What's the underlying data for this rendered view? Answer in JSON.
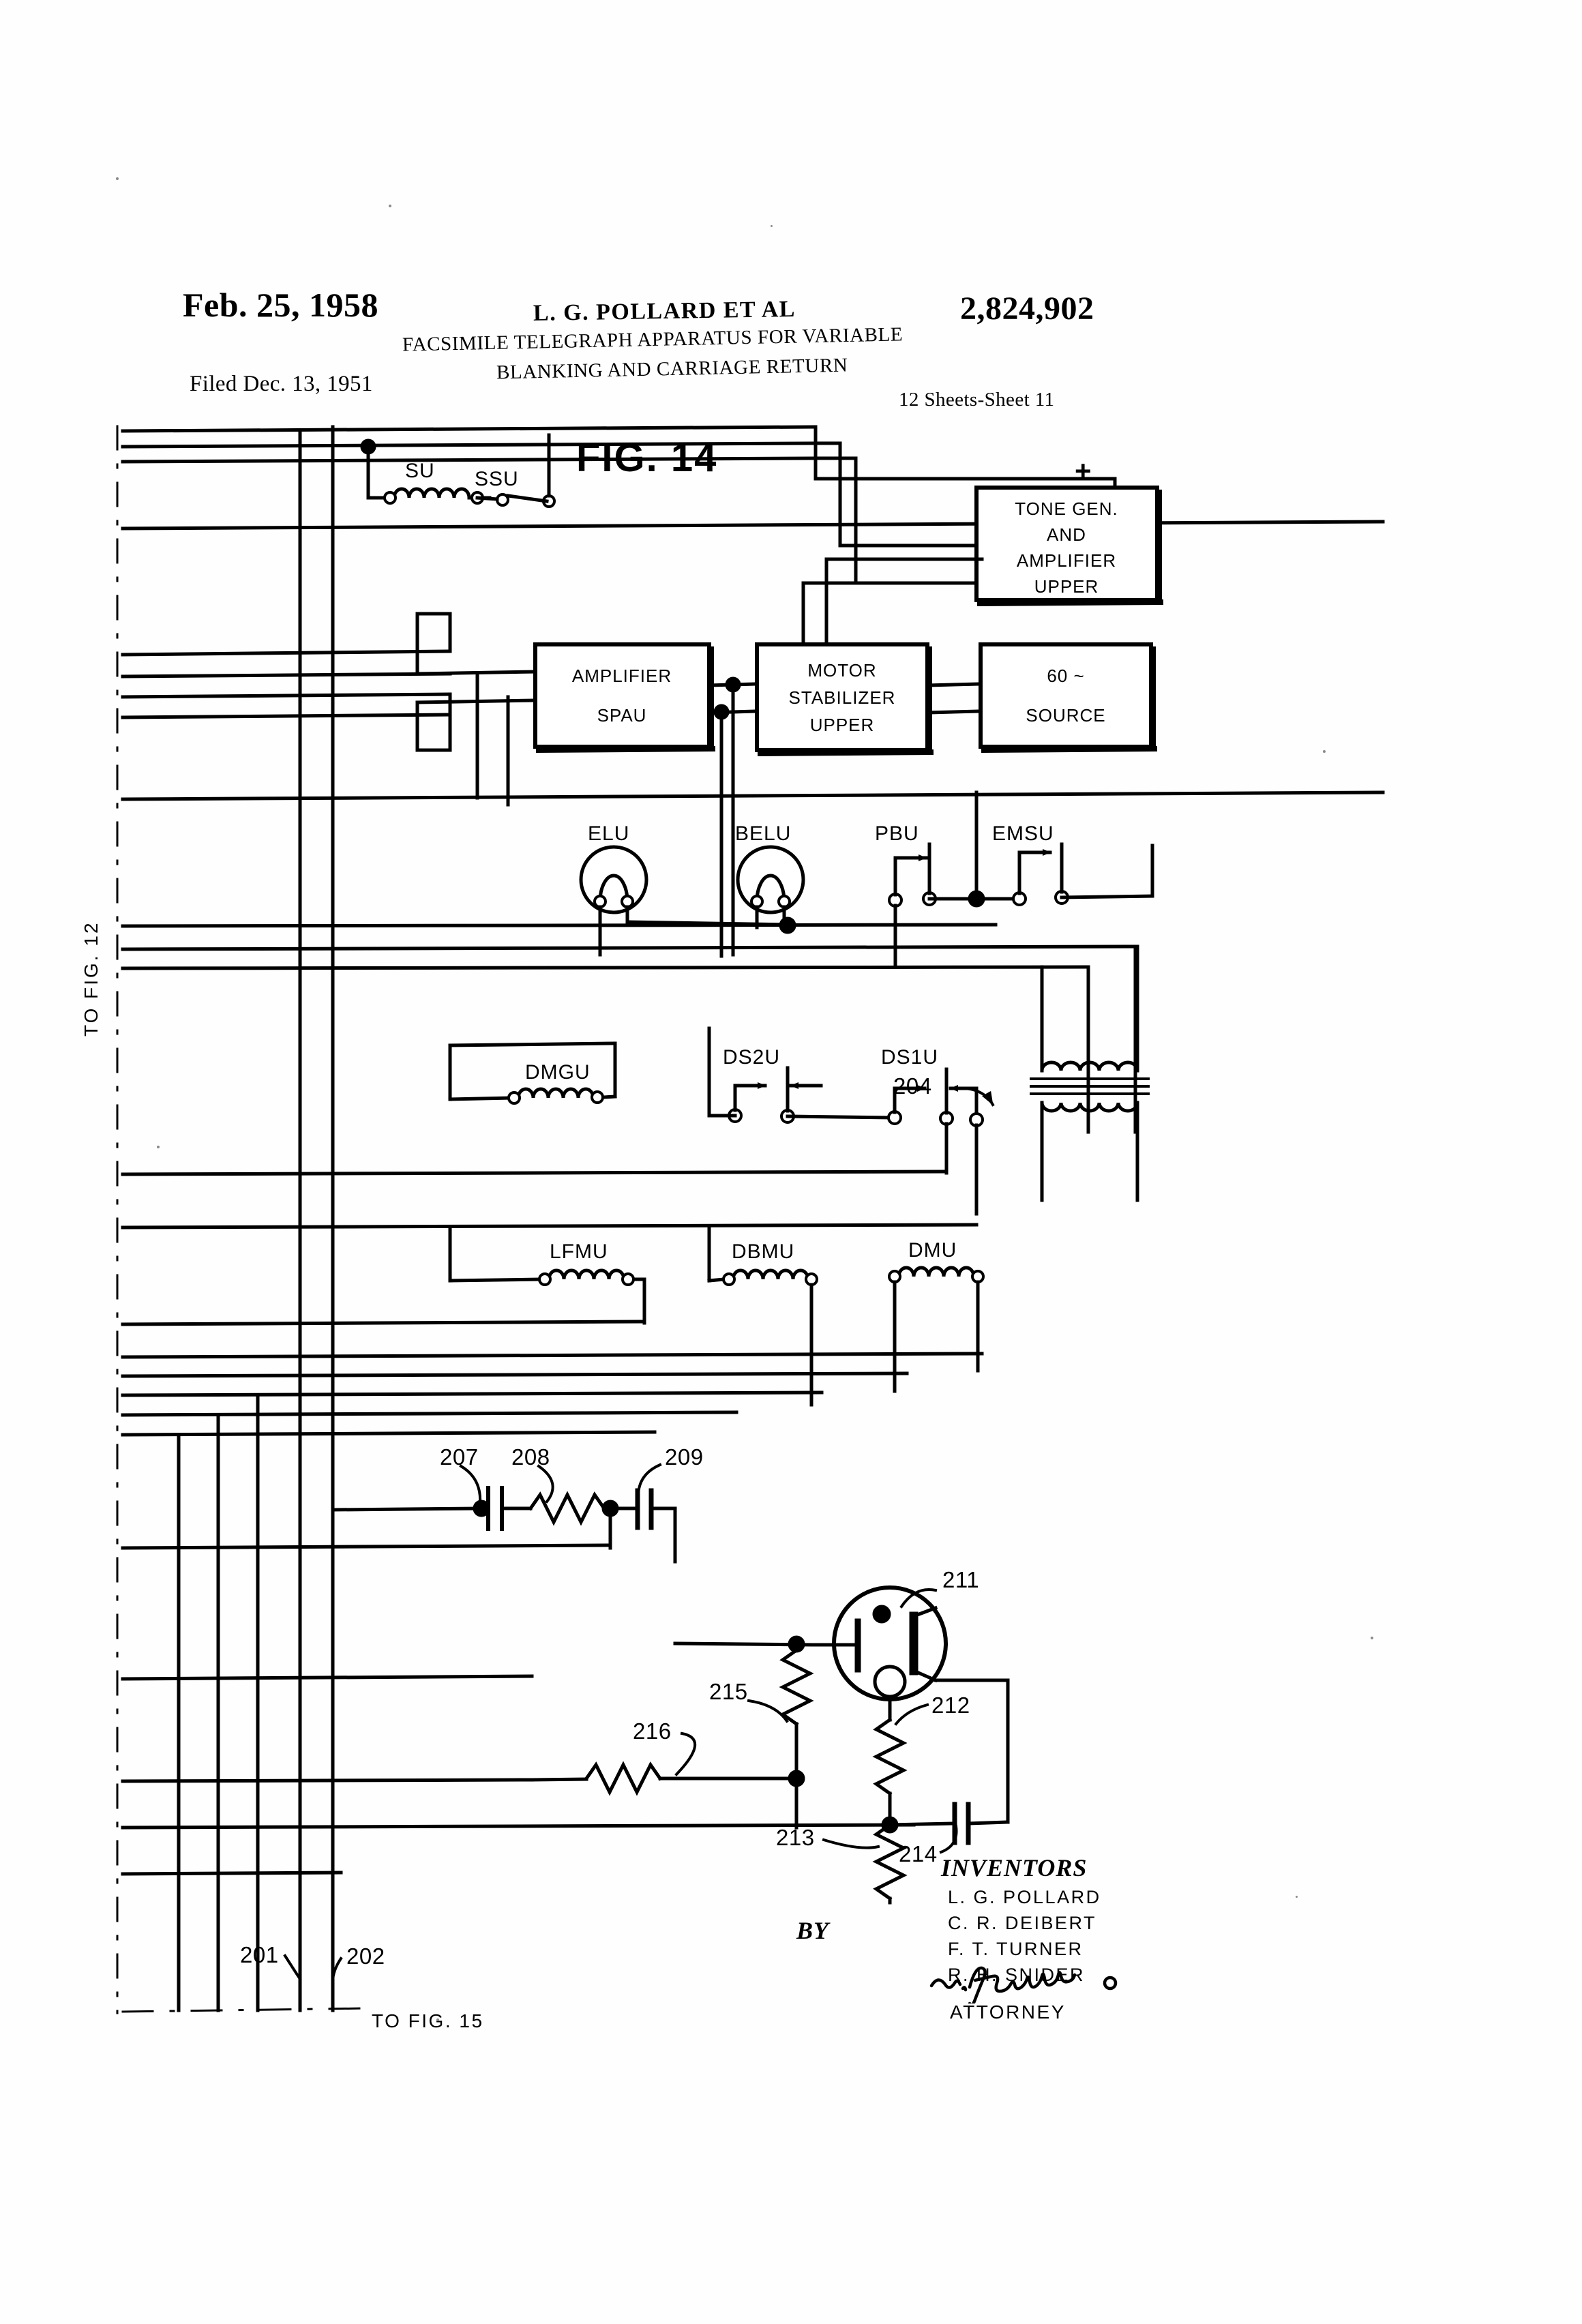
{
  "header": {
    "date": "Feb. 25, 1958",
    "inventor_line": "L. G. POLLARD  ET AL",
    "patent_number": "2,824,902",
    "title_line1": "FACSIMILE TELEGRAPH APPARATUS FOR VARIABLE",
    "title_line2": "BLANKING AND CARRIAGE RETURN",
    "filed": "Filed Dec. 13, 1951",
    "sheets": "12 Sheets-Sheet 11"
  },
  "figure": {
    "label": "FIG. 14",
    "to_fig_left": "TO FIG. 12",
    "to_fig_bottom": "TO FIG. 15"
  },
  "boxes": [
    {
      "id": "tone-gen",
      "lines": [
        "TONE GEN.",
        "AND",
        "AMPLIFIER",
        "UPPER"
      ]
    },
    {
      "id": "amplifier",
      "lines": [
        "AMPLIFIER",
        "SPAU"
      ]
    },
    {
      "id": "motor-stab",
      "lines": [
        "MOTOR",
        "STABILIZER",
        "UPPER"
      ]
    },
    {
      "id": "source",
      "lines": [
        "60 ~",
        "SOURCE"
      ]
    }
  ],
  "polarity": {
    "plus": "+"
  },
  "components": {
    "relay_su": "SU",
    "switch_ssu": "SSU",
    "lamp_elu": "ELU",
    "lamp_belu": "BELU",
    "switch_pbu": "PBU",
    "switch_emsu": "EMSU",
    "coil_dmgu": "DMGU",
    "switch_ds2u": "DS2U",
    "switch_ds1u": "DS1U",
    "coil_lfmu": "LFMU",
    "coil_dbmu": "DBMU",
    "coil_dmu": "DMU"
  },
  "reference_numerals": {
    "n201": "201",
    "n202": "202",
    "n204": "204",
    "n207": "207",
    "n208": "208",
    "n209": "209",
    "n211": "211",
    "n212": "212",
    "n213": "213",
    "n214": "214",
    "n215": "215",
    "n216": "216"
  },
  "signature": {
    "inventors_heading": "INVENTORS",
    "names": [
      "L.  G.  POLLARD",
      "C.  R.  DEIBERT",
      "F.  T.  TURNER",
      "R.  H.  SNIDER"
    ],
    "by": "BY",
    "attorney": "ATTORNEY"
  },
  "colors": {
    "ink": "#000000",
    "paper": "#fefefe"
  }
}
